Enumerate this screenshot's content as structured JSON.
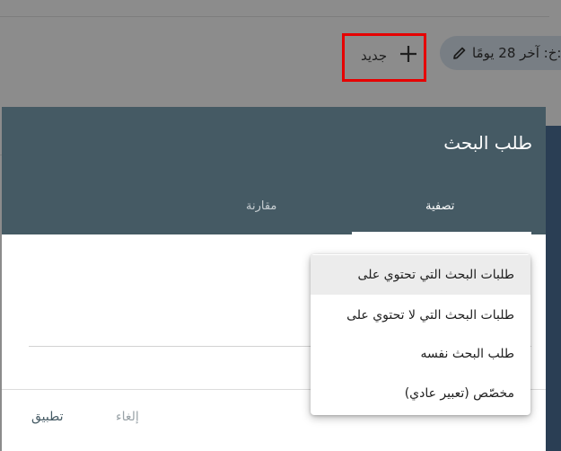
{
  "toolbar": {
    "date_range": ":خ: آخر 28 يومًا",
    "new_label": "جديد"
  },
  "dialog": {
    "title": "طلب البحث",
    "tabs": [
      {
        "label": "تصفية",
        "active": true
      },
      {
        "label": "مقارنة",
        "active": false
      }
    ],
    "apply_label": "تطبيق",
    "cancel_label": "إلغاء"
  },
  "menu": {
    "items": [
      {
        "label": "طلبات البحث التي تحتوي على",
        "highlighted": true
      },
      {
        "label": "طلبات البحث التي لا تحتوي على",
        "highlighted": false
      },
      {
        "label": "طلب البحث نفسه",
        "highlighted": false
      },
      {
        "label": "مخصّص (تعبير عادي)",
        "highlighted": false
      }
    ]
  },
  "colors": {
    "header": "#455a64",
    "highlight_box": "#e60000",
    "backdrop": "#8c8c8c"
  },
  "icons": [
    "pencil-icon",
    "plus-icon"
  ]
}
